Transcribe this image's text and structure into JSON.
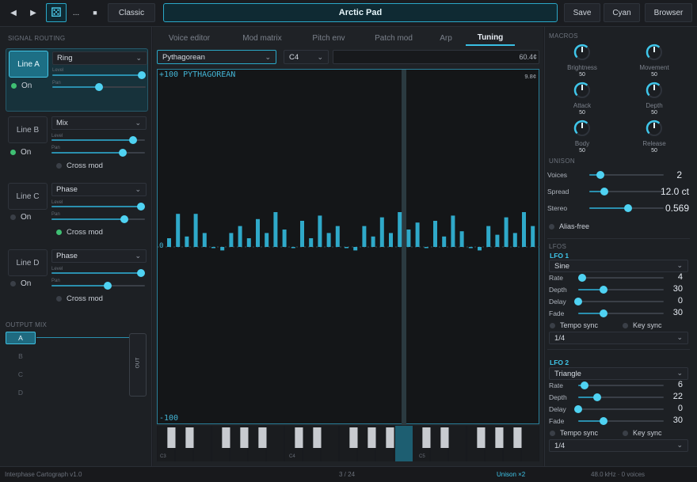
{
  "toolbar": {
    "back_icon": "◀",
    "play_icon": "▶",
    "dice_icon": "⚄",
    "more_label": "...",
    "stop_icon": "■",
    "theme_classic": "Classic",
    "patch_name": "Arctic Pad",
    "save_label": "Save",
    "cyan_label": "Cyan",
    "browser_label": "Browser"
  },
  "routing": {
    "title": "SIGNAL ROUTING",
    "level_label": "Level",
    "pan_label": "Pan",
    "on_label": "On",
    "crossmod_label": "Cross mod",
    "lines": [
      {
        "name": "Line A",
        "mode": "Ring",
        "level": 0.97,
        "pan": 0.5,
        "on": true,
        "crossmod": null
      },
      {
        "name": "Line B",
        "mode": "Mix",
        "level": 0.9,
        "pan": 0.75,
        "on": true,
        "crossmod": false
      },
      {
        "name": "Line C",
        "mode": "Phase",
        "level": 0.97,
        "pan": 0.77,
        "on": false,
        "crossmod": true
      },
      {
        "name": "Line D",
        "mode": "Phase",
        "level": 0.97,
        "pan": 0.57,
        "on": false,
        "crossmod": false
      }
    ]
  },
  "output_mix": {
    "title": "OUTPUT MIX",
    "buttons": [
      "A",
      "B",
      "C",
      "D"
    ],
    "active": "A",
    "out_label": "OUT"
  },
  "tabs": {
    "items": [
      "Voice editor",
      "Mod matrix",
      "Pitch env",
      "Patch mod",
      "Arp",
      "Tuning"
    ],
    "active": "Tuning"
  },
  "tuning": {
    "scale": "Pythagorean",
    "root": "C4",
    "cents_readout": "60.4¢",
    "graph_top_label": "+100 PYTHAGOREAN",
    "graph_top_right": "9.8¢",
    "zero_label": "0",
    "bottom_label": "-100",
    "keyboard_labels": [
      "C3",
      "C4",
      "C5"
    ]
  },
  "chart_data": {
    "type": "bar",
    "ylim": [
      -100,
      100
    ],
    "values": [
      5,
      19,
      6,
      19,
      8,
      0,
      -2,
      8,
      12,
      5,
      16,
      8,
      20,
      10,
      0,
      15,
      5,
      18,
      8,
      12,
      0,
      -2,
      12,
      6,
      17,
      8,
      20,
      10,
      14,
      0,
      15,
      6,
      18,
      9,
      0,
      -2,
      12,
      7,
      17,
      8,
      20,
      12
    ]
  },
  "macros": {
    "title": "MACROS",
    "knobs": [
      {
        "label": "Brightness",
        "value": "50"
      },
      {
        "label": "Movement",
        "value": "50"
      },
      {
        "label": "Attack",
        "value": "50"
      },
      {
        "label": "Depth",
        "value": "50"
      },
      {
        "label": "Body",
        "value": "50"
      },
      {
        "label": "Release",
        "value": "50"
      }
    ]
  },
  "unison": {
    "title": "UNISON",
    "voices_label": "Voices",
    "voices_value": "2",
    "voices_level": 0.15,
    "spread_label": "Spread",
    "spread_value": "12.0 ct",
    "spread_level": 0.2,
    "stereo_label": "Stereo",
    "stereo_value": "0.569",
    "stereo_level": 0.52,
    "alias_label": "Alias-free"
  },
  "lfos": {
    "title": "LFOS",
    "tempo_label": "Tempo sync",
    "key_label": "Key sync",
    "items": [
      {
        "title": "LFO 1",
        "wave": "Sine",
        "division": "1/4",
        "params": [
          {
            "label": "Rate",
            "value": "4",
            "level": 0.05
          },
          {
            "label": "Depth",
            "value": "30",
            "level": 0.3
          },
          {
            "label": "Delay",
            "value": "0",
            "level": 0.0
          },
          {
            "label": "Fade",
            "value": "30",
            "level": 0.3
          }
        ]
      },
      {
        "title": "LFO 2",
        "wave": "Triangle",
        "division": "1/4",
        "params": [
          {
            "label": "Rate",
            "value": "6",
            "level": 0.07
          },
          {
            "label": "Depth",
            "value": "22",
            "level": 0.22
          },
          {
            "label": "Delay",
            "value": "0",
            "level": 0.0
          },
          {
            "label": "Fade",
            "value": "30",
            "level": 0.3
          }
        ]
      }
    ]
  },
  "status": {
    "app": "Interphase Cartograph v1.0",
    "page": "3 / 24",
    "unison": "Unison ×2",
    "engine": "48.0 kHz · 0 voices"
  }
}
